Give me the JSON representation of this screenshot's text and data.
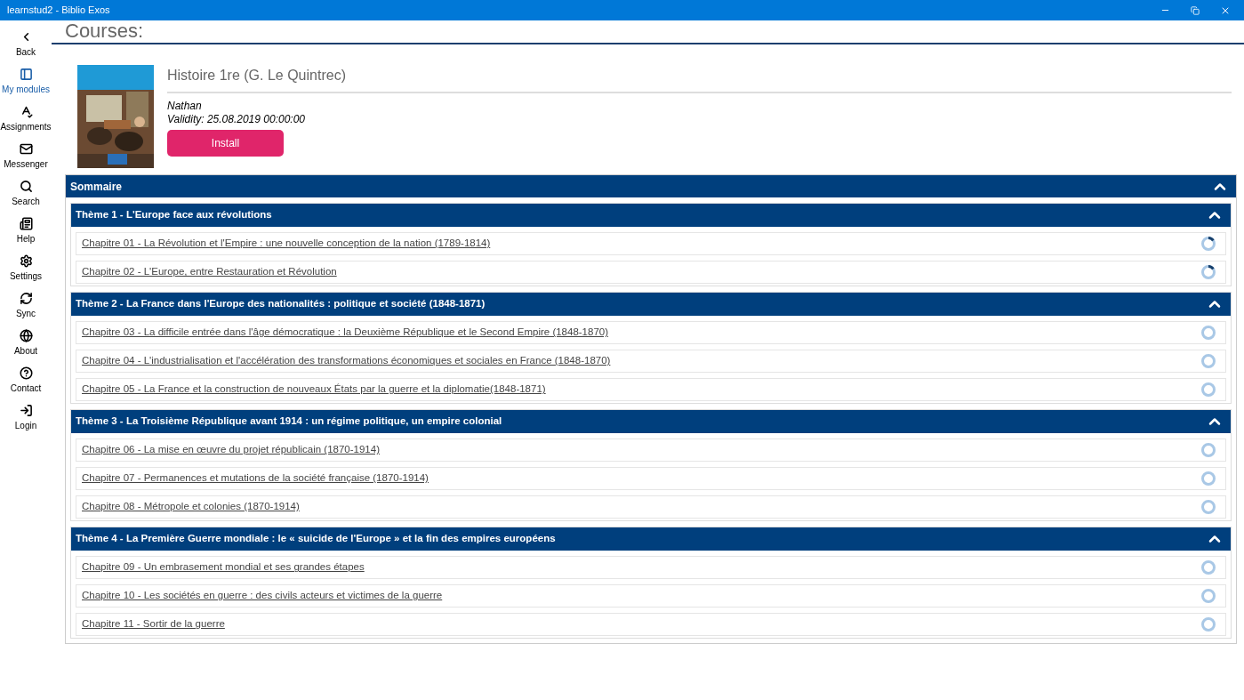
{
  "window": {
    "title": "learnstud2 - Biblio Exos"
  },
  "sidebar": {
    "items": [
      {
        "label": "Back",
        "selected": false
      },
      {
        "label": "My modules",
        "selected": true
      },
      {
        "label": "Assignments",
        "selected": false
      },
      {
        "label": "Messenger",
        "selected": false
      },
      {
        "label": "Search",
        "selected": false
      },
      {
        "label": "Help",
        "selected": false
      },
      {
        "label": "Settings",
        "selected": false
      },
      {
        "label": "Sync",
        "selected": false
      },
      {
        "label": "About",
        "selected": false
      },
      {
        "label": "Contact",
        "selected": false
      },
      {
        "label": "Login",
        "selected": false
      }
    ]
  },
  "page_title": "Courses:",
  "course": {
    "title": "Histoire 1re (G. Le Quintrec)",
    "publisher": "Nathan",
    "validity": "Validity: 25.08.2019 00:00:00",
    "button": "Install"
  },
  "summary": {
    "title": "Sommaire",
    "expanded": true,
    "themes": [
      {
        "title": "Thème 1 - L'Europe face aux révolutions",
        "expanded": true,
        "chapters": [
          {
            "title": "Chapitre 01 - La Révolution et l'Empire : une nouvelle conception de la nation (1789-1814)",
            "level": 0.15
          },
          {
            "title": "Chapitre 02 - L'Europe, entre Restauration et Révolution",
            "level": 0.15
          }
        ]
      },
      {
        "title": "Thème 2 - La France dans l'Europe des nationalités : politique et société (1848-1871)",
        "expanded": true,
        "chapters": [
          {
            "title": "Chapitre 03 - La difficile entrée dans l'âge démocratique : la Deuxième République et le Second Empire (1848-1870)",
            "level": 0
          },
          {
            "title": "Chapitre 04 - L'industrialisation et l'accélération des transformations économiques et sociales en France (1848-1870)",
            "level": 0
          },
          {
            "title": "Chapitre 05 - La France et la construction de nouveaux États par la guerre et la diplomatie(1848-1871)",
            "level": 0
          }
        ]
      },
      {
        "title": "Thème 3 - La Troisième République avant 1914 : un régime politique, un empire colonial",
        "expanded": true,
        "chapters": [
          {
            "title": "Chapitre 06 - La mise en œuvre du projet républicain (1870-1914)",
            "level": 0
          },
          {
            "title": "Chapitre 07 - Permanences et mutations de la société française (1870-1914)",
            "level": 0
          },
          {
            "title": "Chapitre 08 - Métropole et colonies (1870-1914)",
            "level": 0
          }
        ]
      },
      {
        "title": "Thème 4 - La Première Guerre mondiale : le « suicide de l'Europe » et la fin des empires européens",
        "expanded": true,
        "chapters": [
          {
            "title": "Chapitre 09 - Un embrasement mondial et ses grandes étapes",
            "level": 0
          },
          {
            "title": "Chapitre 10 - Les sociétés en guerre : des civils acteurs et victimes de la guerre",
            "level": 0
          },
          {
            "title": "Chapitre 11 - Sortir de la guerre",
            "level": 0
          }
        ]
      }
    ]
  }
}
